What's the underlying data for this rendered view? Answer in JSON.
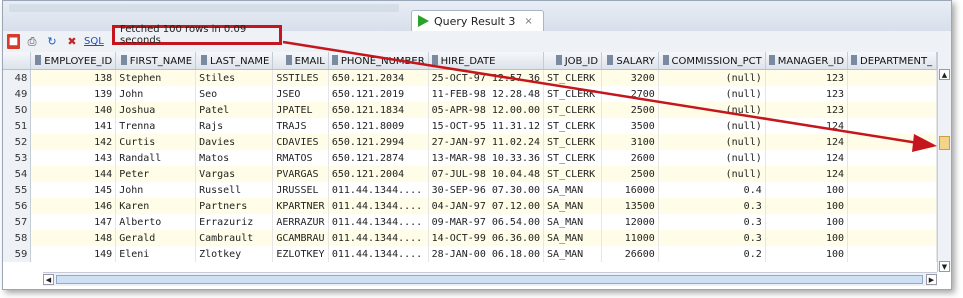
{
  "tab": {
    "label": "Query Result 3",
    "close": "×"
  },
  "toolbar": {
    "sql_label": "SQL",
    "status": "Fetched 100 rows in 0.09 seconds"
  },
  "icons": [
    "pin-icon",
    "print-icon",
    "refresh-icon",
    "delete-icon",
    "play-icon",
    "close-icon"
  ],
  "colors": {
    "highlight_box": "#c4161c",
    "arrow": "#c4161c",
    "row_alt": "#fffde7"
  },
  "columns": [
    "EMPLOYEE_ID",
    "FIRST_NAME",
    "LAST_NAME",
    "EMAIL",
    "PHONE_NUMBER",
    "HIRE_DATE",
    "JOB_ID",
    "SALARY",
    "COMMISSION_PCT",
    "MANAGER_ID",
    "DEPARTMENT_"
  ],
  "rows": [
    {
      "n": "48",
      "employee_id": "138",
      "first_name": "Stephen",
      "last_name": "Stiles",
      "email": "SSTILES",
      "phone": "650.121.2034",
      "hire_date": "25-OCT-97 12.57.36",
      "job_id": "ST_CLERK",
      "salary": "3200",
      "commission": "(null)",
      "manager_id": "123",
      "department": ""
    },
    {
      "n": "49",
      "employee_id": "139",
      "first_name": "John",
      "last_name": "Seo",
      "email": "JSEO",
      "phone": "650.121.2019",
      "hire_date": "11-FEB-98 12.28.48",
      "job_id": "ST_CLERK",
      "salary": "2700",
      "commission": "(null)",
      "manager_id": "123",
      "department": ""
    },
    {
      "n": "50",
      "employee_id": "140",
      "first_name": "Joshua",
      "last_name": "Patel",
      "email": "JPATEL",
      "phone": "650.121.1834",
      "hire_date": "05-APR-98 12.00.00",
      "job_id": "ST_CLERK",
      "salary": "2500",
      "commission": "(null)",
      "manager_id": "123",
      "department": ""
    },
    {
      "n": "51",
      "employee_id": "141",
      "first_name": "Trenna",
      "last_name": "Rajs",
      "email": "TRAJS",
      "phone": "650.121.8009",
      "hire_date": "15-OCT-95 11.31.12",
      "job_id": "ST_CLERK",
      "salary": "3500",
      "commission": "(null)",
      "manager_id": "124",
      "department": ""
    },
    {
      "n": "52",
      "employee_id": "142",
      "first_name": "Curtis",
      "last_name": "Davies",
      "email": "CDAVIES",
      "phone": "650.121.2994",
      "hire_date": "27-JAN-97 11.02.24",
      "job_id": "ST_CLERK",
      "salary": "3100",
      "commission": "(null)",
      "manager_id": "124",
      "department": ""
    },
    {
      "n": "53",
      "employee_id": "143",
      "first_name": "Randall",
      "last_name": "Matos",
      "email": "RMATOS",
      "phone": "650.121.2874",
      "hire_date": "13-MAR-98 10.33.36",
      "job_id": "ST_CLERK",
      "salary": "2600",
      "commission": "(null)",
      "manager_id": "124",
      "department": ""
    },
    {
      "n": "54",
      "employee_id": "144",
      "first_name": "Peter",
      "last_name": "Vargas",
      "email": "PVARGAS",
      "phone": "650.121.2004",
      "hire_date": "07-JUL-98 10.04.48",
      "job_id": "ST_CLERK",
      "salary": "2500",
      "commission": "(null)",
      "manager_id": "124",
      "department": ""
    },
    {
      "n": "55",
      "employee_id": "145",
      "first_name": "John",
      "last_name": "Russell",
      "email": "JRUSSEL",
      "phone": "011.44.1344....",
      "hire_date": "30-SEP-96 07.30.00",
      "job_id": "SA_MAN",
      "salary": "16000",
      "commission": "0.4",
      "manager_id": "100",
      "department": ""
    },
    {
      "n": "56",
      "employee_id": "146",
      "first_name": "Karen",
      "last_name": "Partners",
      "email": "KPARTNER",
      "phone": "011.44.1344....",
      "hire_date": "04-JAN-97 07.12.00",
      "job_id": "SA_MAN",
      "salary": "13500",
      "commission": "0.3",
      "manager_id": "100",
      "department": ""
    },
    {
      "n": "57",
      "employee_id": "147",
      "first_name": "Alberto",
      "last_name": "Errazuriz",
      "email": "AERRAZUR",
      "phone": "011.44.1344....",
      "hire_date": "09-MAR-97 06.54.00",
      "job_id": "SA_MAN",
      "salary": "12000",
      "commission": "0.3",
      "manager_id": "100",
      "department": ""
    },
    {
      "n": "58",
      "employee_id": "148",
      "first_name": "Gerald",
      "last_name": "Cambrault",
      "email": "GCAMBRAU",
      "phone": "011.44.1344....",
      "hire_date": "14-OCT-99 06.36.00",
      "job_id": "SA_MAN",
      "salary": "11000",
      "commission": "0.3",
      "manager_id": "100",
      "department": ""
    },
    {
      "n": "59",
      "employee_id": "149",
      "first_name": "Eleni",
      "last_name": "Zlotkey",
      "email": "EZLOTKEY",
      "phone": "011.44.1344....",
      "hire_date": "28-JAN-00 06.18.00",
      "job_id": "SA_MAN",
      "salary": "26600",
      "commission": "0.2",
      "manager_id": "100",
      "department": ""
    }
  ]
}
